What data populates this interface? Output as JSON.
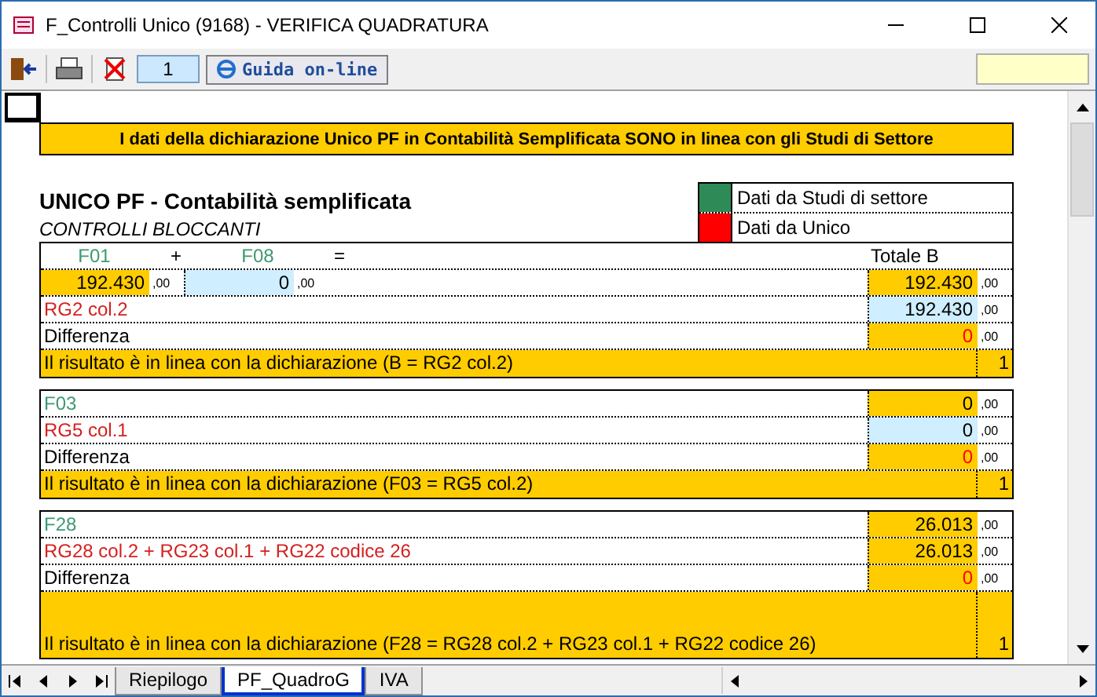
{
  "window": {
    "title": "F_Controlli Unico (9168) - VERIFICA QUADRATURA"
  },
  "toolbar": {
    "page_field": "1",
    "help_button": "Guida on-line"
  },
  "banner": "I dati della dichiarazione Unico PF in Contabilità Semplificata SONO  in linea con gli Studi di Settore",
  "section": {
    "title": "UNICO PF - Contabilità semplificata",
    "subtitle": "CONTROLLI BLOCCANTI"
  },
  "legend": [
    {
      "color": "#2e8b57",
      "label": "Dati da Studi di settore"
    },
    {
      "color": "#ff0000",
      "label": "Dati da Unico"
    }
  ],
  "blocks": [
    {
      "rows": [
        {
          "kind": "header",
          "terms": [
            {
              "kind": "term",
              "text": "F01"
            },
            {
              "kind": "op",
              "text": "+"
            },
            {
              "kind": "term",
              "text": "F08"
            },
            {
              "kind": "op",
              "text": "="
            }
          ],
          "total": "Totale B"
        },
        {
          "kind": "operands",
          "operands": [
            {
              "value": "192.430",
              "decimals": ",00",
              "input": false
            },
            {
              "value": "0",
              "decimals": ",00",
              "input": true
            }
          ],
          "value": "192.430",
          "decimals": ",00",
          "input": false,
          "alert": false
        },
        {
          "kind": "line",
          "label": "RG2 col.2",
          "color": "#d42020",
          "value": "192.430",
          "decimals": ",00",
          "input": true,
          "alert": false
        },
        {
          "kind": "line",
          "label": "Differenza",
          "color": "#000000",
          "value": "0",
          "decimals": ",00",
          "input": false,
          "alert": true
        }
      ],
      "result": {
        "text": "Il risultato è in linea con la dichiarazione (B = RG2 col.2)",
        "value": "1",
        "tall": false
      }
    },
    {
      "rows": [
        {
          "kind": "line",
          "label": "F03",
          "color": "#3d9970",
          "value": "0",
          "decimals": ",00",
          "input": false,
          "alert": false
        },
        {
          "kind": "line",
          "label": "RG5 col.1",
          "color": "#d42020",
          "value": "0",
          "decimals": ",00",
          "input": true,
          "alert": false
        },
        {
          "kind": "line",
          "label": "Differenza",
          "color": "#000000",
          "value": "0",
          "decimals": ",00",
          "input": false,
          "alert": true
        }
      ],
      "result": {
        "text": "Il risultato è in linea con la dichiarazione (F03 = RG5 col.2)",
        "value": "1",
        "tall": false
      }
    },
    {
      "rows": [
        {
          "kind": "line",
          "label": "F28",
          "color": "#3d9970",
          "value": "26.013",
          "decimals": ",00",
          "input": false,
          "alert": false
        },
        {
          "kind": "line",
          "label": "RG28 col.2 + RG23 col.1 + RG22 codice 26",
          "color": "#d42020",
          "value": "26.013",
          "decimals": ",00",
          "input": false,
          "alert": false
        },
        {
          "kind": "line",
          "label": "Differenza",
          "color": "#000000",
          "value": "0",
          "decimals": ",00",
          "input": false,
          "alert": true
        }
      ],
      "result": {
        "text": "Il risultato è in linea con la dichiarazione (F28 = RG28 col.2 + RG23 col.1 + RG22 codice 26)",
        "value": "1",
        "tall": true
      }
    }
  ],
  "sheet_tabs": [
    {
      "label": "Riepilogo",
      "selected": false
    },
    {
      "label": "PF_QuadroG",
      "selected": true
    },
    {
      "label": "IVA",
      "selected": false
    }
  ]
}
